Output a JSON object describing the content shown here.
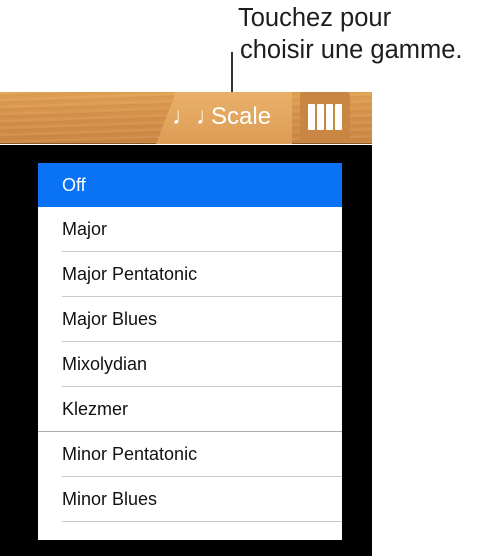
{
  "callout": {
    "line1": "Touchez pour",
    "line2": "choisir une gamme."
  },
  "toolbar": {
    "scale_icon": "♩♩",
    "scale_label": "Scale",
    "keys_icon": "keyboard-keys-icon"
  },
  "scale_list": {
    "selected": "Off",
    "items": [
      {
        "label": "Off"
      },
      {
        "label": "Major"
      },
      {
        "label": "Major Pentatonic"
      },
      {
        "label": "Major Blues"
      },
      {
        "label": "Mixolydian"
      },
      {
        "label": "Klezmer"
      },
      {
        "label": "Minor Pentatonic"
      },
      {
        "label": "Minor Blues"
      },
      {
        "label": ""
      }
    ]
  },
  "colors": {
    "selection": "#0a73f5",
    "toolbar_wood": "#d7924a",
    "panel_background": "#000000"
  }
}
